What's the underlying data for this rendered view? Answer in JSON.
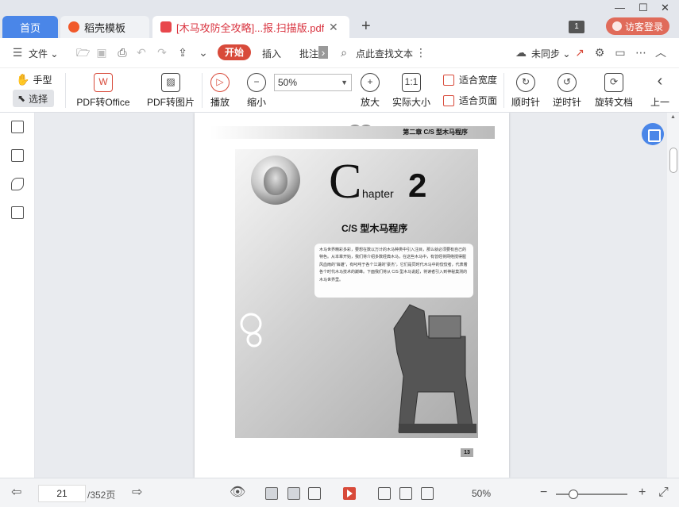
{
  "tabs": {
    "home": "首页",
    "templates": "稻壳模板",
    "document": "[木马攻防全攻略]...报.扫描版.pdf",
    "new_tab": "+"
  },
  "topbar": {
    "badge": "1",
    "login": "访客登录"
  },
  "menu": {
    "file": "文件",
    "start": "开始",
    "insert": "插入",
    "annotate": "批注",
    "search": "点此查找文本",
    "sync": "未同步"
  },
  "ribbon": {
    "hand": "手型",
    "select": "选择",
    "pdf_to_office": "PDF转Office",
    "pdf_to_image": "PDF转图片",
    "play": "播放",
    "zoom_out": "缩小",
    "zoom_value": "50%",
    "zoom_in": "放大",
    "actual_size": "实际大小",
    "fit_width": "适合宽度",
    "fit_page": "适合页面",
    "rotate_cw": "顺时针",
    "rotate_ccw": "逆时针",
    "rotate_doc": "旋转文档",
    "prev": "上一"
  },
  "page": {
    "header": "第二章  C/S 型木马程序",
    "big_c": "C",
    "hapter": "hapter",
    "chapter_num": "2",
    "chapter_title": "C/S 型木马程序",
    "intro": "木马世界精彩多彩，要想在数以万计的木马种类中引入注目，那么就必须要有自己的特色。从本章开始，我们将介绍多数经典木马，在这些木马中，有曾经将网络搅得腥风血雨的“枭雄”，有叱咤于各个江湖的“豪杰”，它们是同时代木马中的佼佼者，代表着各个时代木马技术的巅峰。下面我们将从 C/S 型木马说起，将读者引入到神秘莫测的木马世界里。",
    "page_number": "13"
  },
  "status": {
    "current_page": "21",
    "total_pages": "/352页",
    "zoom": "50%"
  }
}
